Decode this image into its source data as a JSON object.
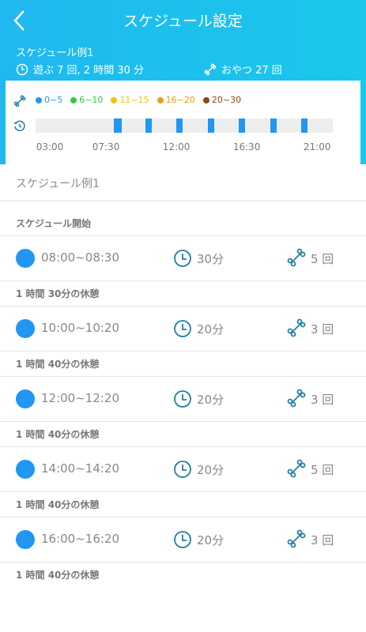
{
  "header": {
    "title": "スケジュール設定",
    "schedule_name": "スケジュール例1",
    "play_summary": "遊ぶ 7 回, 2 時間 30 分",
    "treat_summary": "おやつ 27 回"
  },
  "legend": [
    {
      "label": "0~5",
      "color": "#2196f3"
    },
    {
      "label": "6~10",
      "color": "#2ecc40"
    },
    {
      "label": "11~15",
      "color": "#f5c211"
    },
    {
      "label": "16~20",
      "color": "#f39c12"
    },
    {
      "label": "20~30",
      "color": "#8b4a12"
    }
  ],
  "timeline": {
    "ticks": [
      "03:00",
      "07:30",
      "12:00",
      "16:30",
      "21:00"
    ]
  },
  "chart_data": {
    "type": "bar",
    "x_range": [
      "03:00",
      "22:00"
    ],
    "x_ticks": [
      "03:00",
      "07:30",
      "12:00",
      "16:30",
      "21:00"
    ],
    "sessions": [
      {
        "start": "08:00",
        "end": "08:30"
      },
      {
        "start": "10:00",
        "end": "10:20"
      },
      {
        "start": "12:00",
        "end": "12:20"
      },
      {
        "start": "14:00",
        "end": "14:20"
      },
      {
        "start": "16:00",
        "end": "16:20"
      },
      {
        "start": "18:00",
        "end": "18:20"
      },
      {
        "start": "20:00",
        "end": "20:20"
      }
    ]
  },
  "schedule": {
    "name_field": "スケジュール例1",
    "start_label": "スケジュール開始",
    "items": [
      {
        "time": "08:00~08:30",
        "duration": "30分",
        "treats": "5 回"
      },
      {
        "time": "10:00~10:20",
        "duration": "20分",
        "treats": "3 回"
      },
      {
        "time": "12:00~12:20",
        "duration": "20分",
        "treats": "3 回"
      },
      {
        "time": "14:00~14:20",
        "duration": "20分",
        "treats": "5 回"
      },
      {
        "time": "16:00~16:20",
        "duration": "20分",
        "treats": "3 回"
      }
    ],
    "rests": [
      "1 時間 30分の休憩",
      "1 時間 40分の休憩",
      "1 時間 40分の休憩",
      "1 時間 40分の休憩",
      "1 時間 40分の休憩"
    ]
  },
  "colors": {
    "accent": "#1fb9ee",
    "session": "#2196f3",
    "icon": "#1f7fa6"
  }
}
